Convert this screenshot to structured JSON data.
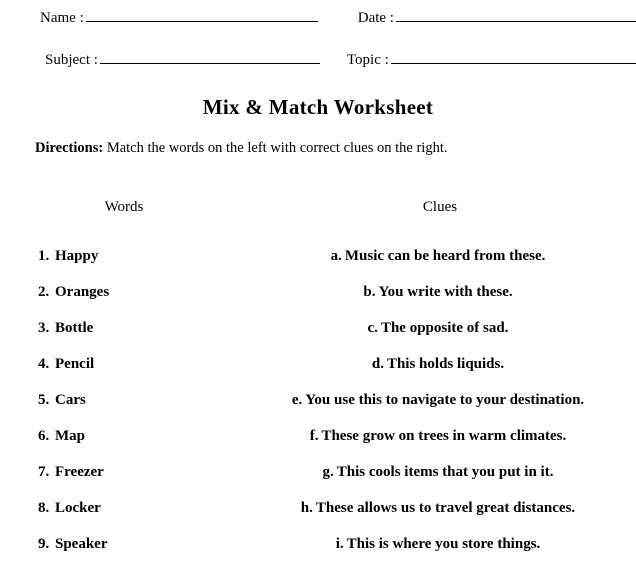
{
  "header": {
    "fields": [
      {
        "name": "name",
        "label": "Name :",
        "value": ""
      },
      {
        "name": "date",
        "label": "Date :",
        "value": ""
      },
      {
        "name": "subject",
        "label": "Subject :",
        "value": ""
      },
      {
        "name": "topic",
        "label": "Topic :",
        "value": ""
      }
    ]
  },
  "title": "Mix & Match Worksheet",
  "directions": {
    "label": "Directions:",
    "text": " Match the words on the left with correct clues on the right."
  },
  "columns": {
    "words_heading": "Words",
    "clues_heading": "Clues"
  },
  "words": [
    {
      "marker": "1.",
      "text": "Happy"
    },
    {
      "marker": "2.",
      "text": "Oranges"
    },
    {
      "marker": "3.",
      "text": "Bottle"
    },
    {
      "marker": "4.",
      "text": "Pencil"
    },
    {
      "marker": "5.",
      "text": "Cars"
    },
    {
      "marker": "6.",
      "text": "Map"
    },
    {
      "marker": "7.",
      "text": "Freezer"
    },
    {
      "marker": "8.",
      "text": "Locker"
    },
    {
      "marker": "9.",
      "text": "Speaker"
    }
  ],
  "clues": [
    {
      "marker": "a.",
      "text": "Music can be heard from these."
    },
    {
      "marker": "b.",
      "text": "You write with these."
    },
    {
      "marker": "c.",
      "text": "The opposite of sad."
    },
    {
      "marker": "d.",
      "text": "This holds liquids."
    },
    {
      "marker": "e.",
      "text": "You use this to navigate to your destination."
    },
    {
      "marker": "f.",
      "text": "These grow on trees in warm climates."
    },
    {
      "marker": "g.",
      "text": "This cools items that you put in it."
    },
    {
      "marker": "h.",
      "text": "These allows us to travel great distances."
    },
    {
      "marker": "i.",
      "text": "This is where you store things."
    }
  ],
  "colors": {
    "page_background": "#ffffff",
    "text": "#000000",
    "rule": "#000000"
  }
}
